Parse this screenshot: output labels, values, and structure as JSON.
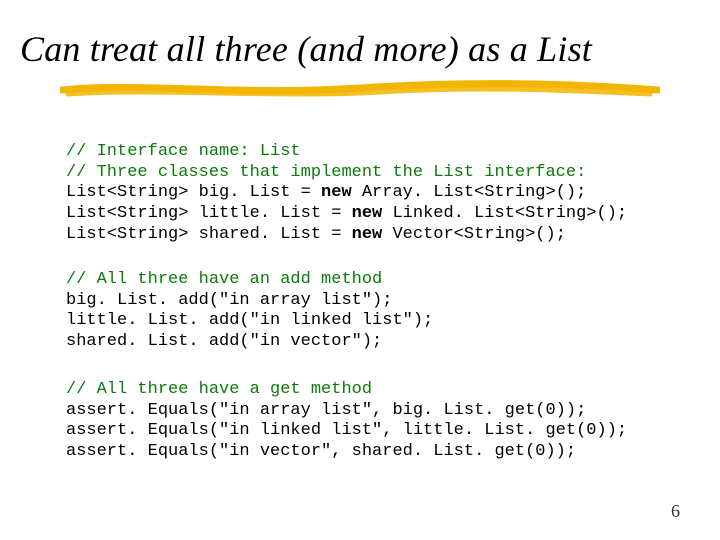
{
  "title": "Can treat all three (and more) as a List",
  "code": {
    "c1": "// Interface name: List",
    "c2": "// Three classes that implement the List interface:",
    "l1a": "List<String> big. List = ",
    "l1kw": "new",
    "l1b": " Array. List<String>();",
    "l2a": "List<String> little. List = ",
    "l2kw": "new",
    "l2b": " Linked. List<String>();",
    "l3a": "List<String> shared. List = ",
    "l3kw": "new",
    "l3b": " Vector<String>();",
    "c3": "// All three have an add method",
    "a1": "big. List. add(\"in array list\");",
    "a2": "little. List. add(\"in linked list\");",
    "a3": "shared. List. add(\"in vector\");",
    "c4": "// All three have a get method",
    "g1": "assert. Equals(\"in array list\", big. List. get(0));",
    "g2": "assert. Equals(\"in linked list\", little. List. get(0));",
    "g3": "assert. Equals(\"in vector\", shared. List. get(0));"
  },
  "page_number": "6",
  "colors": {
    "comment": "#0b7a0b",
    "underline": "#f2b500"
  }
}
